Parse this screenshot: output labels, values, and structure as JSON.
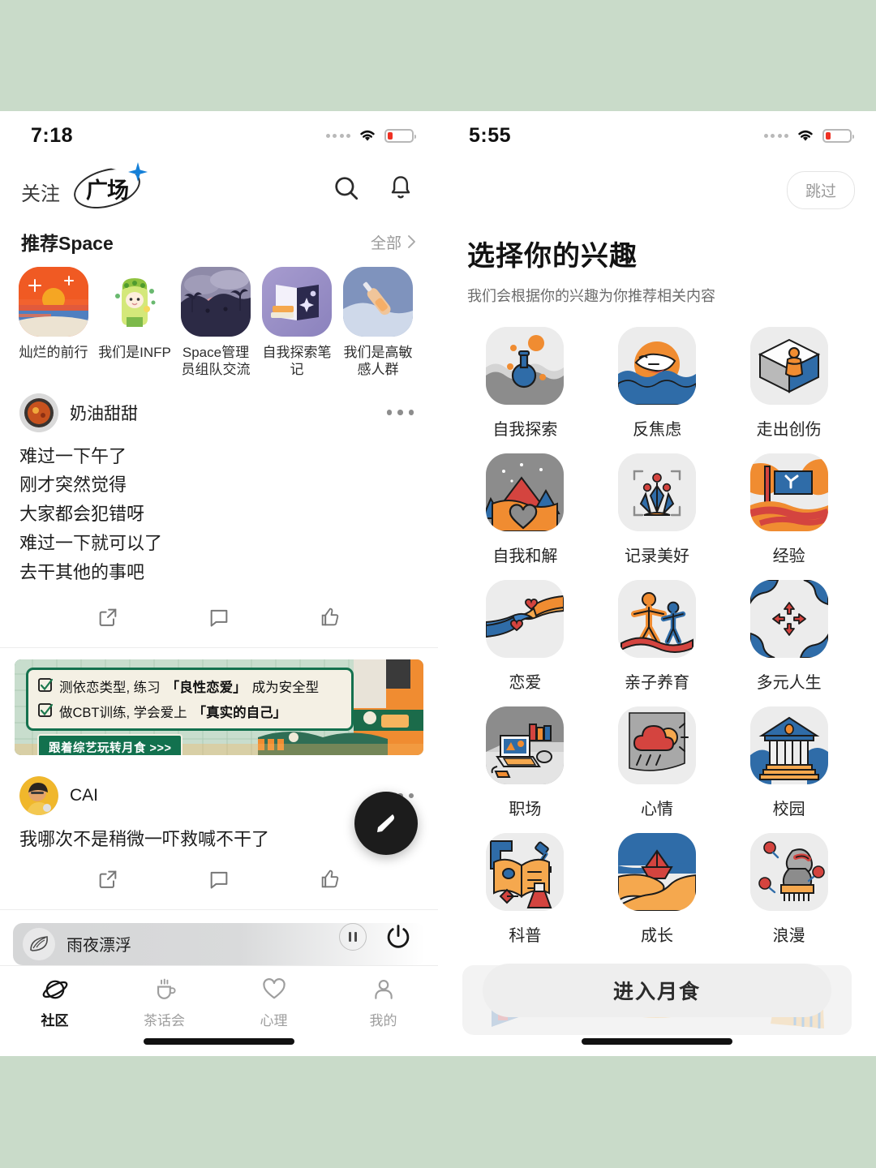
{
  "background_color": "#c9dbc9",
  "left_screen": {
    "status": {
      "time": "7:18",
      "wifi": "wifi-icon",
      "battery_level": "20"
    },
    "nav": {
      "tab_follow": "关注",
      "tab_plaza": "广场",
      "search_icon": "search-icon",
      "bell_icon": "bell-icon"
    },
    "space_section": {
      "title": "推荐Space",
      "more_label": "全部",
      "items": [
        {
          "name": "灿烂的前行",
          "art": "sunset-sea"
        },
        {
          "name": "我们是INFP",
          "art": "green-hair-girl"
        },
        {
          "name": "Space管理员组队交流",
          "art": "dusk-palms"
        },
        {
          "name": "自我探索笔记",
          "art": "open-book-stars"
        },
        {
          "name": "我们是高敏感人群",
          "art": "bottle-snow"
        }
      ]
    },
    "posts": [
      {
        "user": "奶油甜甜",
        "avatar": "food-bowl-avatar",
        "lines": [
          "难过一下午了",
          "刚才突然觉得",
          "大家都会犯错呀",
          "难过一下就可以了",
          "去干其他的事吧"
        ],
        "actions": [
          "share-icon",
          "comment-icon",
          "like-icon"
        ]
      },
      {
        "user": "CAI",
        "avatar": "person-yellow-avatar",
        "lines": [
          "我哪次不是稍微一吓救喊不干了"
        ],
        "actions": [
          "share-icon",
          "comment-icon",
          "like-icon"
        ]
      }
    ],
    "banner": {
      "line1_a": "测依恋类型, 练习",
      "line1_b": "「良性恋爱」",
      "line1_c": "成为安全型",
      "line2_a": "做CBT训练, 学会爱上",
      "line2_b": "「真实的自己」",
      "chip": "跟着综艺玩转月食 >>>"
    },
    "player": {
      "icon": "leaf-sound-icon",
      "track": "雨夜漂浮",
      "pause_icon": "pause-icon",
      "power_icon": "power-icon"
    },
    "fab": {
      "icon": "compose-pen-icon"
    },
    "tabbar": [
      {
        "label": "社区",
        "icon": "planet-icon",
        "active": true
      },
      {
        "label": "茶话会",
        "icon": "teacup-icon",
        "active": false
      },
      {
        "label": "心理",
        "icon": "heart-icon",
        "active": false
      },
      {
        "label": "我的",
        "icon": "person-icon",
        "active": false
      }
    ]
  },
  "right_screen": {
    "status": {
      "time": "5:55",
      "wifi": "wifi-icon",
      "battery_level": "20"
    },
    "skip_label": "跳过",
    "title": "选择你的兴趣",
    "subtitle": "我们会根据你的兴趣为你推荐相关内容",
    "interests": [
      {
        "label": "自我探索",
        "art": "flask-sea"
      },
      {
        "label": "反焦虑",
        "art": "bear-wave-sun"
      },
      {
        "label": "走出创伤",
        "art": "person-in-cube"
      },
      {
        "label": "自我和解",
        "art": "mountain-heart"
      },
      {
        "label": "记录美好",
        "art": "plant-frame"
      },
      {
        "label": "经验",
        "art": "flag-signpost"
      },
      {
        "label": "恋爱",
        "art": "two-hands-heart"
      },
      {
        "label": "亲子养育",
        "art": "parent-child"
      },
      {
        "label": "多元人生",
        "art": "four-arrows"
      },
      {
        "label": "职场",
        "art": "laptop-desk"
      },
      {
        "label": "心情",
        "art": "rain-cloud-sun"
      },
      {
        "label": "校园",
        "art": "campus-building"
      },
      {
        "label": "科普",
        "art": "book-microscope"
      },
      {
        "label": "成长",
        "art": "paper-boat-beach"
      },
      {
        "label": "浪漫",
        "art": "statue-roses"
      }
    ],
    "cta_label": "进入月食"
  }
}
